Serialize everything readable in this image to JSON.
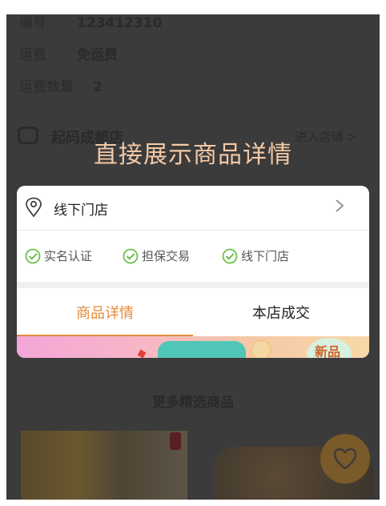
{
  "background": {
    "rows": [
      {
        "label": "编号",
        "value": "123412310"
      },
      {
        "label": "运费",
        "value": "免运费"
      },
      {
        "label": "运费数量",
        "value": "2"
      }
    ],
    "shop": {
      "name": "起码成都店",
      "enter_label": "进入店铺 >"
    },
    "overlay_title": "直接展示商品详情",
    "more_title": "更多精选商品"
  },
  "card": {
    "store_label": "线下门店",
    "badges": [
      {
        "label": "实名认证",
        "icon": "check-circle-icon"
      },
      {
        "label": "担保交易",
        "icon": "check-circle-icon"
      },
      {
        "label": "线下门店",
        "icon": "check-circle-icon"
      }
    ],
    "tabs": [
      {
        "label": "商品详情",
        "active": true
      },
      {
        "label": "本店成交",
        "active": false
      }
    ],
    "banner_badge": "新品"
  },
  "colors": {
    "accent": "#e38a3d",
    "check_green": "#6cc04a",
    "overlay_text": "#f3c9a6",
    "dim_background": "#3b3b3b"
  }
}
